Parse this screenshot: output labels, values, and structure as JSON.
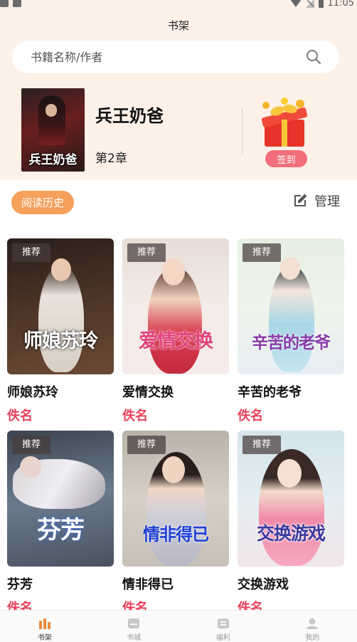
{
  "status_bar": {
    "time": "11:05"
  },
  "header": {
    "title": "书架"
  },
  "search": {
    "placeholder": "书籍名称/作者"
  },
  "current_book": {
    "title": "兵王奶爸",
    "chapter": "第2章",
    "cover_text": "兵王奶爸"
  },
  "signin": {
    "label": "签到"
  },
  "toolbar": {
    "history_label": "阅读历史",
    "manage_label": "管理"
  },
  "books": [
    {
      "name": "师娘苏玲",
      "author": "佚名",
      "badge": "推荐",
      "cover_title": "师娘苏玲",
      "cover_title_color": "#ffffff"
    },
    {
      "name": "爱情交换",
      "author": "佚名",
      "badge": "推荐",
      "cover_title": "爱情交换",
      "cover_title_color": "#e0447e"
    },
    {
      "name": "辛苦的老爷",
      "author": "佚名",
      "badge": "推荐",
      "cover_title": "辛苦的老爷",
      "cover_title_color": "#8a3aa8"
    },
    {
      "name": "芬芳",
      "author": "佚名",
      "badge": "推荐",
      "cover_title": "芬芳",
      "cover_title_color": "#ffffff"
    },
    {
      "name": "情非得已",
      "author": "佚名",
      "badge": "推荐",
      "cover_title": "情非得已",
      "cover_title_color": "#1f3fd6"
    },
    {
      "name": "交换游戏",
      "author": "佚名",
      "badge": "推荐",
      "cover_title": "交换游戏",
      "cover_title_color": "#3a3aa0"
    }
  ],
  "nav": [
    {
      "label": "书架",
      "icon": "bookshelf-icon",
      "active": true
    },
    {
      "label": "书城",
      "icon": "bookstore-icon",
      "active": false
    },
    {
      "label": "福利",
      "icon": "welfare-icon",
      "active": false
    },
    {
      "label": "我的",
      "icon": "profile-icon",
      "active": false
    }
  ],
  "colors": {
    "accent": "#f5a05b",
    "author": "#e8415a",
    "signin": "#f06f7a",
    "nav_active": "#f08a3a"
  }
}
